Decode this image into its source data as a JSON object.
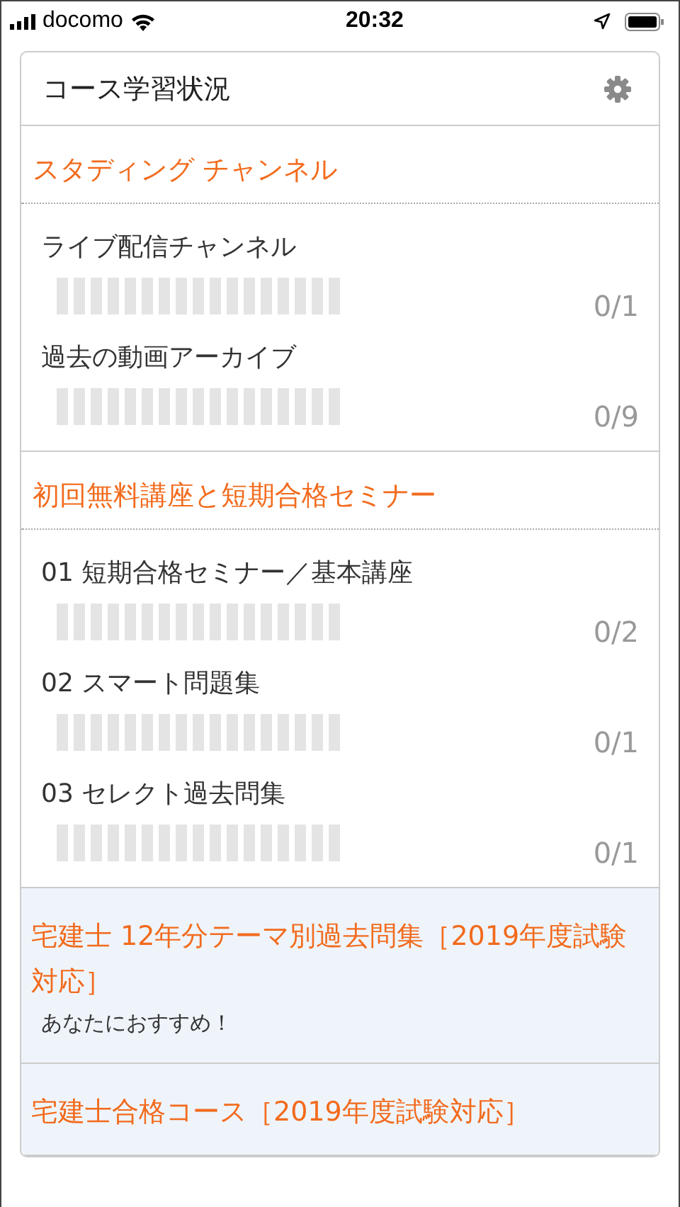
{
  "status_bar": {
    "carrier": "docomo",
    "time": "20:32"
  },
  "card": {
    "title": "コース学習状況",
    "sections": [
      {
        "title": "スタディング チャンネル",
        "items": [
          {
            "name": "ライブ配信チャンネル",
            "count": "0/1"
          },
          {
            "name": "過去の動画アーカイブ",
            "count": "0/9"
          }
        ]
      },
      {
        "title": "初回無料講座と短期合格セミナー",
        "items": [
          {
            "name": "01 短期合格セミナー／基本講座",
            "count": "0/2"
          },
          {
            "name": "02 スマート問題集",
            "count": "0/1"
          },
          {
            "name": "03 セレクト過去問集",
            "count": "0/1"
          }
        ]
      }
    ],
    "recommendations": [
      {
        "title": "宅建士 12年分テーマ別過去問集［2019年度試験対応］",
        "note": "あなたにおすすめ！"
      },
      {
        "title": "宅建士合格コース［2019年度試験対応］"
      }
    ]
  }
}
